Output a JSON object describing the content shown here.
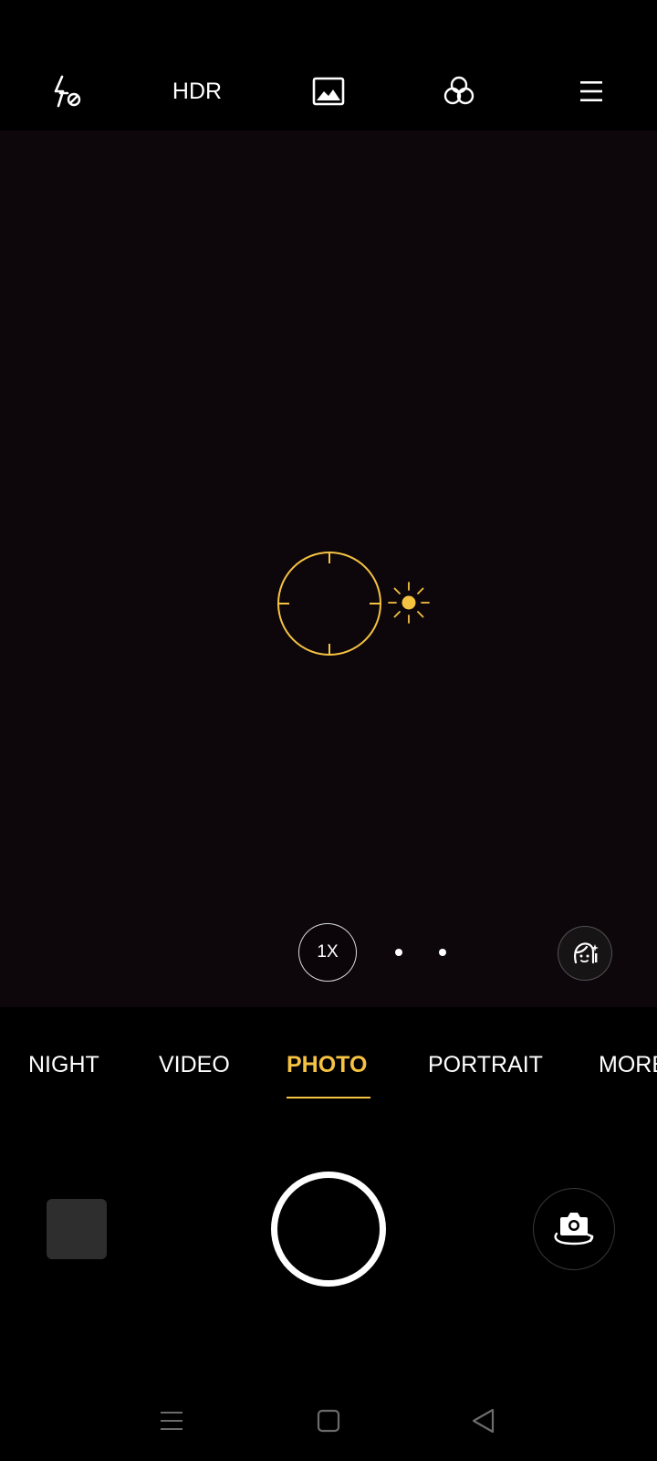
{
  "top_bar": {
    "flash_icon": "flash-off-icon",
    "hdr_label": "HDR",
    "gallery_icon": "image-icon",
    "filter_icon": "filters-icon",
    "menu_icon": "menu-icon"
  },
  "viewfinder": {
    "focus_icon": "focus-ring-icon",
    "exposure_icon": "sun-icon",
    "zoom_label": "1X",
    "beauty_icon": "beauty-face-icon"
  },
  "modes": {
    "items": [
      {
        "label": "NIGHT",
        "active": false
      },
      {
        "label": "VIDEO",
        "active": false
      },
      {
        "label": "PHOTO",
        "active": true
      },
      {
        "label": "PORTRAIT",
        "active": false
      },
      {
        "label": "MORE",
        "active": false
      }
    ]
  },
  "colors": {
    "accent": "#f5c242",
    "background": "#000000",
    "viewfinder": "#0d070b"
  },
  "controls": {
    "thumbnail_icon": "last-photo-thumbnail",
    "shutter_icon": "shutter-icon",
    "switch_icon": "switch-camera-icon"
  },
  "system_nav": {
    "recents_icon": "recents-icon",
    "home_icon": "home-icon",
    "back_icon": "back-icon"
  }
}
